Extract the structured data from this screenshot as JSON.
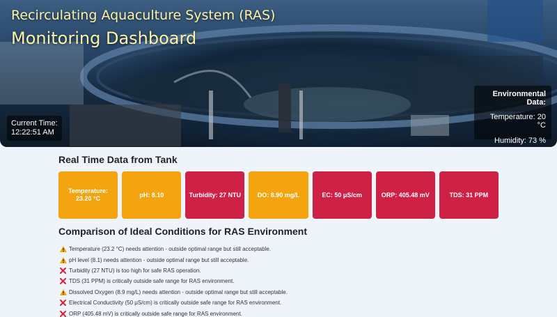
{
  "header": {
    "title_line1": "Recirculating Aquaculture System (RAS)",
    "title_line2": "Monitoring Dashboard"
  },
  "time": {
    "label": "Current Time:",
    "value": "12:22:51 AM"
  },
  "environment": {
    "heading": "Environmental Data:",
    "temperature": "Temperature: 20 °C",
    "humidity": "Humidity: 73 %"
  },
  "realtime": {
    "title": "Real Time Data from Tank",
    "cards": [
      {
        "label": "Temperature: 23.20 °C",
        "status": "warning"
      },
      {
        "label": "pH: 8.10",
        "status": "warning"
      },
      {
        "label": "Turbidity: 27 NTU",
        "status": "critical"
      },
      {
        "label": "DO: 8.90 mg/L",
        "status": "warning"
      },
      {
        "label": "EC: 50 μS/cm",
        "status": "critical"
      },
      {
        "label": "ORP: 405.48 mV",
        "status": "critical"
      },
      {
        "label": "TDS: 31 PPM",
        "status": "critical"
      }
    ]
  },
  "comparison": {
    "title": "Comparison of Ideal Conditions for RAS Environment",
    "items": [
      {
        "icon": "warning-icon",
        "text": "Temperature (23.2 °C) needs attention - outside optimal range but still acceptable."
      },
      {
        "icon": "warning-icon",
        "text": "pH level (8.1) needs attention - outside optimal range but still acceptable."
      },
      {
        "icon": "cross-icon",
        "text": "Turbidity (27 NTU) is too high for safe RAS operation."
      },
      {
        "icon": "cross-icon",
        "text": "TDS (31 PPM) is critically outside safe range for RAS environment."
      },
      {
        "icon": "warning-icon",
        "text": "Dissolved Oxygen (8.9 mg/L) needs attention - outside optimal range but still acceptable."
      },
      {
        "icon": "cross-icon",
        "text": "Electrical Conductivity (50 μS/cm) is critically outside safe range for RAS environment."
      },
      {
        "icon": "cross-icon",
        "text": "ORP (405.48 mV) is critically outside safe range for RAS environment."
      }
    ]
  },
  "colors": {
    "warning": "#f4a40e",
    "critical": "#cf2046",
    "title_text": "#fbf3a8"
  }
}
